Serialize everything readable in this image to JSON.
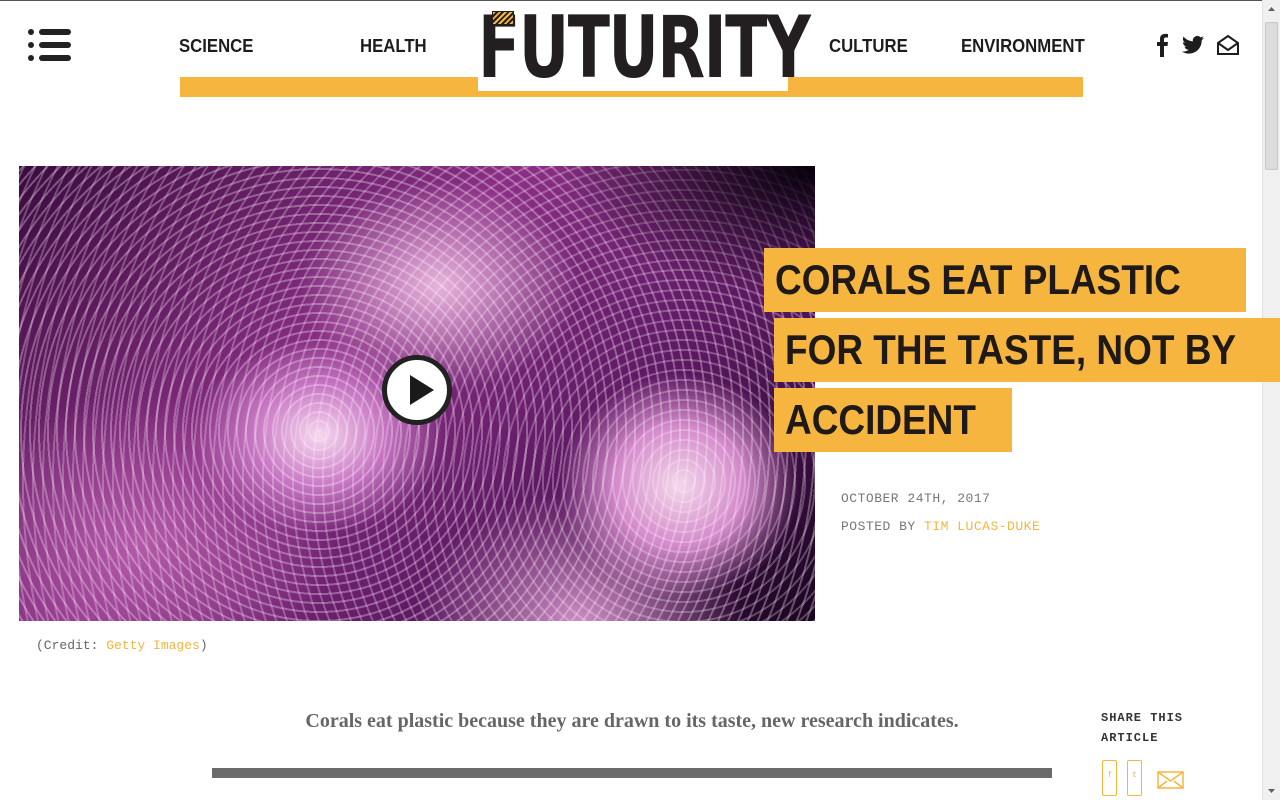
{
  "nav": {
    "left": [
      "SCIENCE",
      "HEALTH"
    ],
    "right": [
      "CULTURE",
      "ENVIRONMENT"
    ]
  },
  "logo": {
    "text": "FUTURITY"
  },
  "social": {
    "icons": [
      "facebook-icon",
      "twitter-icon",
      "email-icon"
    ]
  },
  "article": {
    "headline_lines": [
      "CORALS EAT PLASTIC",
      "FOR THE TASTE, NOT BY",
      "ACCIDENT"
    ],
    "date": "OCTOBER 24TH, 2017",
    "posted_by_label": "POSTED BY",
    "author": "TIM LUCAS-DUKE",
    "credit_prefix": "(Credit: ",
    "credit_source": "Getty Images",
    "credit_suffix": ")",
    "lede": "Corals eat plastic because they are drawn to its taste, new research indicates."
  },
  "share": {
    "label": "SHARE THIS ARTICLE",
    "buttons": [
      "facebook-share-icon",
      "twitter-share-icon",
      "email-share-icon"
    ]
  },
  "colors": {
    "accent": "#f5b53f",
    "text_dark": "#1f1a17",
    "meta_gray": "#777777"
  }
}
